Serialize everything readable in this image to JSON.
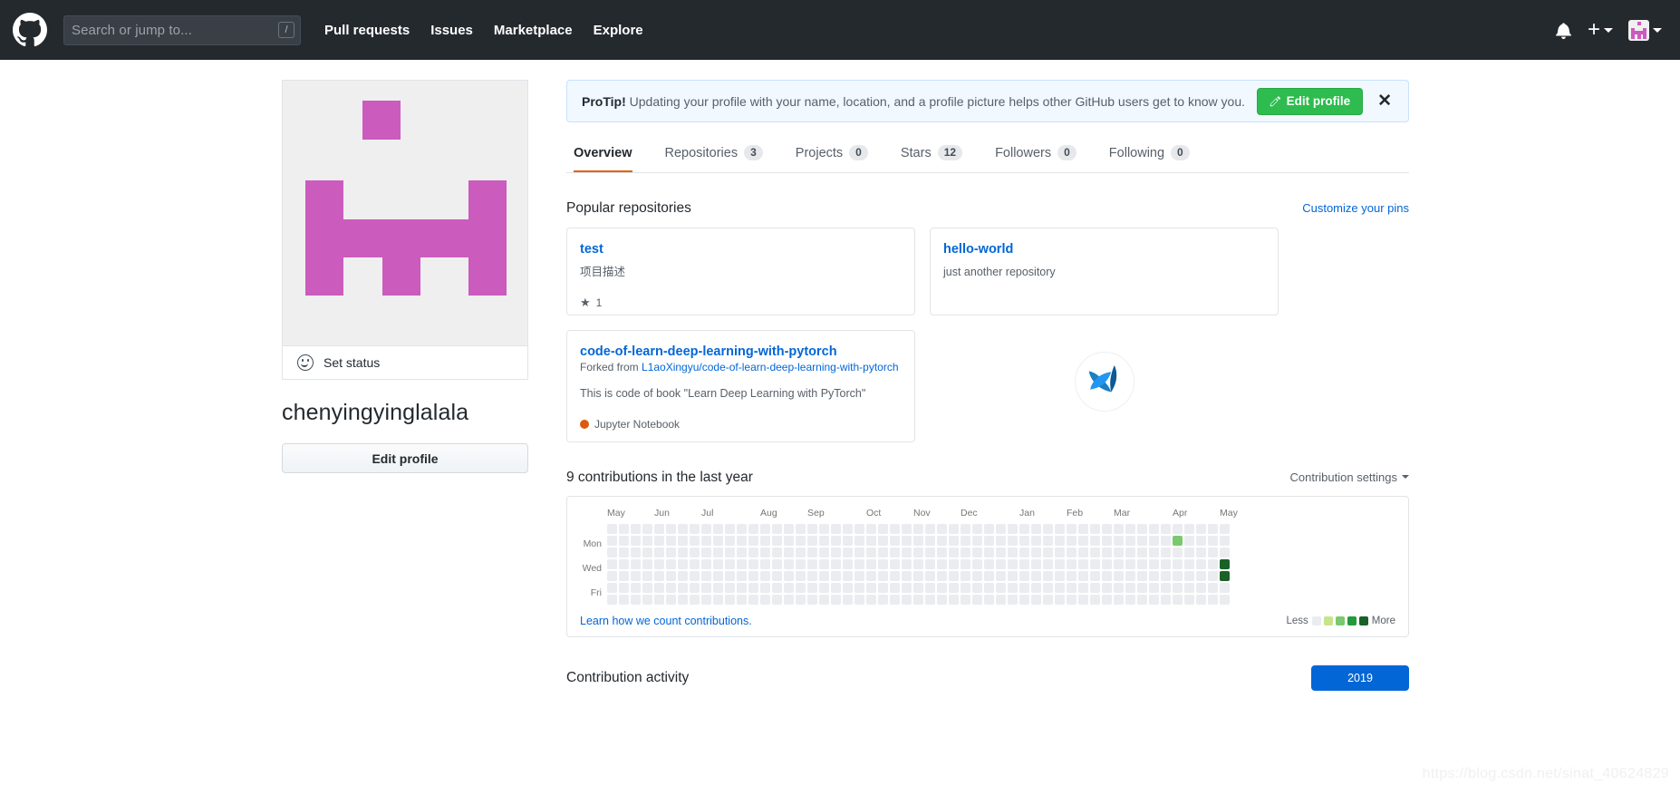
{
  "header": {
    "logo_icon": "github-mark-icon",
    "search": {
      "placeholder": "Search or jump to...",
      "value": "",
      "shortcut": "/"
    },
    "nav": [
      {
        "label": "Pull requests"
      },
      {
        "label": "Issues"
      },
      {
        "label": "Marketplace"
      },
      {
        "label": "Explore"
      }
    ],
    "notifications_icon": "bell-icon",
    "create_new_icon": "plus-icon",
    "account_icon": "user-avatar-icon",
    "bg_color": "#24292e"
  },
  "protip": {
    "label": "ProTip!",
    "message": " Updating your profile with your name, location, and a profile picture helps other GitHub users get to know you.",
    "button_label": "Edit profile",
    "button_icon": "pencil-icon",
    "close_icon": "close-icon",
    "accent_color": "#2ebc4f"
  },
  "profile": {
    "avatar_icon": "identicon-avatar",
    "avatar_color": "#cb5bbd",
    "status_icon": "smiley-icon",
    "status_label": "Set status",
    "username": "chenyingyinglalala",
    "edit_profile_label": "Edit profile"
  },
  "tabs": [
    {
      "label": "Overview",
      "count": "",
      "active": true
    },
    {
      "label": "Repositories",
      "count": "3",
      "active": false
    },
    {
      "label": "Projects",
      "count": "0",
      "active": false
    },
    {
      "label": "Stars",
      "count": "12",
      "active": false
    },
    {
      "label": "Followers",
      "count": "0",
      "active": false
    },
    {
      "label": "Following",
      "count": "0",
      "active": false
    }
  ],
  "popular": {
    "title": "Popular repositories",
    "customize_label": "Customize your pins",
    "repos": [
      {
        "name": "test",
        "description": "项目描述",
        "stars": "1",
        "star_icon": "star-icon"
      },
      {
        "name": "hello-world",
        "description": "just another repository"
      },
      {
        "name": "code-of-learn-deep-learning-with-pytorch",
        "forked_prefix": "Forked from ",
        "forked_from": "L1aoXingyu/code-of-learn-deep-learning-with-pytorch",
        "description": "This is code of book \"Learn Deep Learning with PyTorch\"",
        "language": "Jupyter Notebook",
        "language_color": "#DA5B0B"
      }
    ],
    "octicon": "octoface-badge-icon"
  },
  "contributions": {
    "title": "9 contributions in the last year",
    "settings_label": "Contribution settings",
    "settings_caret_icon": "chevron-down-icon",
    "months": [
      "May",
      "Jun",
      "Jul",
      "Aug",
      "Sep",
      "Oct",
      "Nov",
      "Dec",
      "Jan",
      "Feb",
      "Mar",
      "Apr",
      "May"
    ],
    "day_labels": [
      "Mon",
      "Wed",
      "Fri"
    ],
    "count_link_label": "Learn how we count contributions.",
    "legend_less": "Less",
    "legend_more": "More",
    "legend_colors": [
      "#eaecef",
      "#c6e48b",
      "#7bc96f",
      "#239a3b",
      "#196127"
    ]
  },
  "chart_data": {
    "type": "heatmap",
    "title": "9 contributions in the last year",
    "xlabel": "",
    "ylabel": "",
    "weeks": 53,
    "days_per_week": 7,
    "month_labels": [
      "May",
      "Jun",
      "Jul",
      "Aug",
      "Sep",
      "Oct",
      "Nov",
      "Dec",
      "Jan",
      "Feb",
      "Mar",
      "Apr",
      "May"
    ],
    "month_week_index": [
      0,
      4,
      8,
      13,
      17,
      22,
      26,
      30,
      35,
      39,
      43,
      48,
      52
    ],
    "day_labels": [
      "Mon",
      "Wed",
      "Fri"
    ],
    "day_label_rows": [
      1,
      3,
      5
    ],
    "levels": [
      0,
      1,
      2,
      3,
      4
    ],
    "level_colors": [
      "#eaecef",
      "#c6e48b",
      "#7bc96f",
      "#239a3b",
      "#196127"
    ],
    "legend_position": "bottom-right",
    "total_contributions": 9,
    "nonzero_cells": [
      {
        "week": 48,
        "day": 1,
        "level": 2
      },
      {
        "week": 52,
        "day": 3,
        "level": 4
      },
      {
        "week": 52,
        "day": 4,
        "level": 4
      }
    ]
  },
  "activity": {
    "title": "Contribution activity",
    "year_label": "2019",
    "year_color": "#0366d6"
  },
  "watermark": {
    "text": "https://blog.csdn.net/sinat_40624829"
  }
}
